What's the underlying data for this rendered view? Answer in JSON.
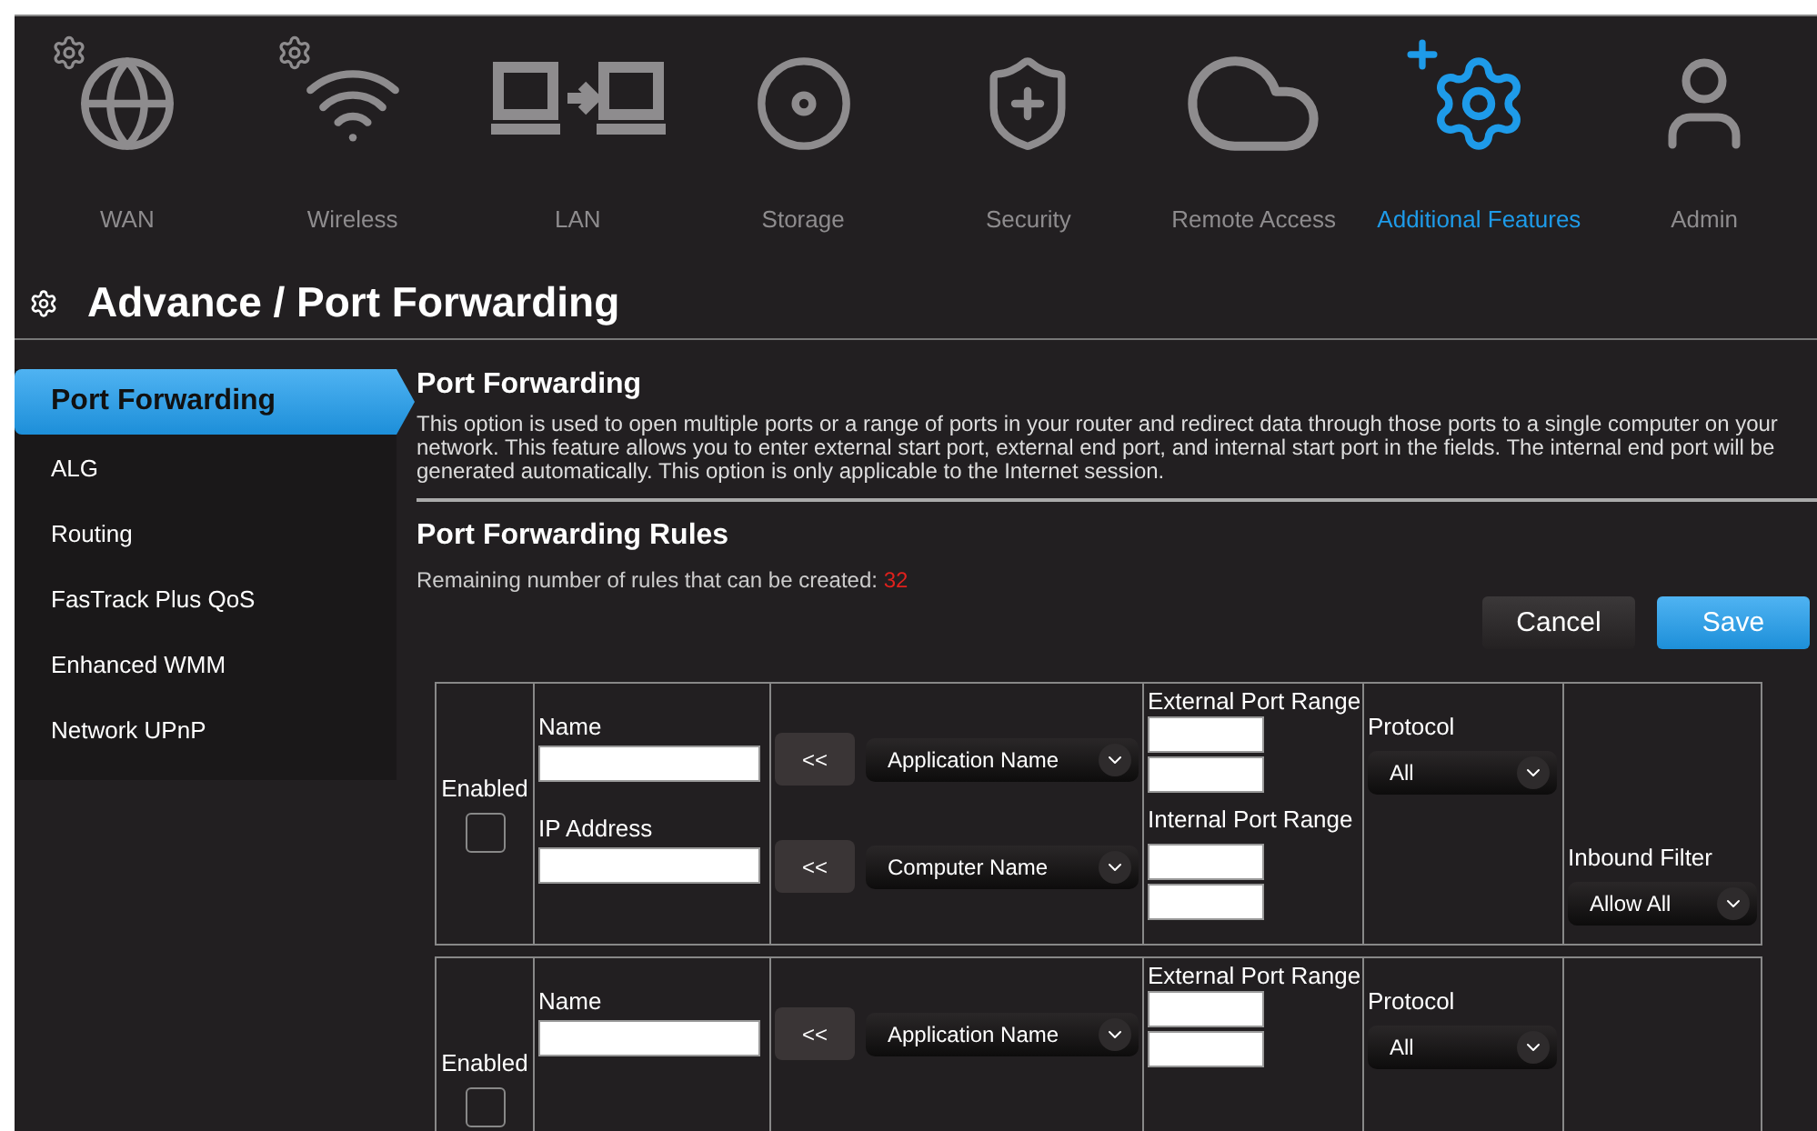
{
  "nav": [
    {
      "label": "WAN",
      "selected": false
    },
    {
      "label": "Wireless",
      "selected": false
    },
    {
      "label": "LAN",
      "selected": false
    },
    {
      "label": "Storage",
      "selected": false
    },
    {
      "label": "Security",
      "selected": false
    },
    {
      "label": "Remote Access",
      "selected": false
    },
    {
      "label": "Additional Features",
      "selected": true
    },
    {
      "label": "Admin",
      "selected": false
    }
  ],
  "page_title": "Advance / Port Forwarding",
  "sidebar": {
    "items": [
      {
        "label": "Port Forwarding",
        "selected": true
      },
      {
        "label": "ALG",
        "selected": false
      },
      {
        "label": "Routing",
        "selected": false
      },
      {
        "label": "FasTrack Plus QoS",
        "selected": false
      },
      {
        "label": "Enhanced WMM",
        "selected": false
      },
      {
        "label": "Network UPnP",
        "selected": false
      }
    ]
  },
  "section_title": "Port Forwarding",
  "description": "This option is used to open multiple ports or a range of ports in your router and redirect data through those ports to a single computer on your network. This feature allows you to enter external start port, external end port, and internal start port in the fields. The internal end port will be generated automatically. This option is only applicable to the Internet session.",
  "rules_title": "Port Forwarding Rules",
  "remaining_label": "Remaining number of rules that can be created:",
  "remaining_count": "32",
  "buttons": {
    "cancel": "Cancel",
    "save": "Save"
  },
  "rules": [
    {
      "enabled_label": "Enabled",
      "checked": false,
      "name_label": "Name",
      "ip_label": "IP Address",
      "copy_button": "<<",
      "application": "Application Name",
      "computer": "Computer Name",
      "external_label": "External Port Range",
      "internal_label": "Internal Port Range",
      "protocol_label": "Protocol",
      "protocol": "All",
      "filter_label": "Inbound Filter",
      "filter": "Allow All"
    },
    {
      "enabled_label": "Enabled",
      "checked": false,
      "name_label": "Name",
      "copy_button": "<<",
      "application": "Application Name",
      "external_label": "External Port Range",
      "protocol_label": "Protocol",
      "protocol": "All"
    }
  ]
}
